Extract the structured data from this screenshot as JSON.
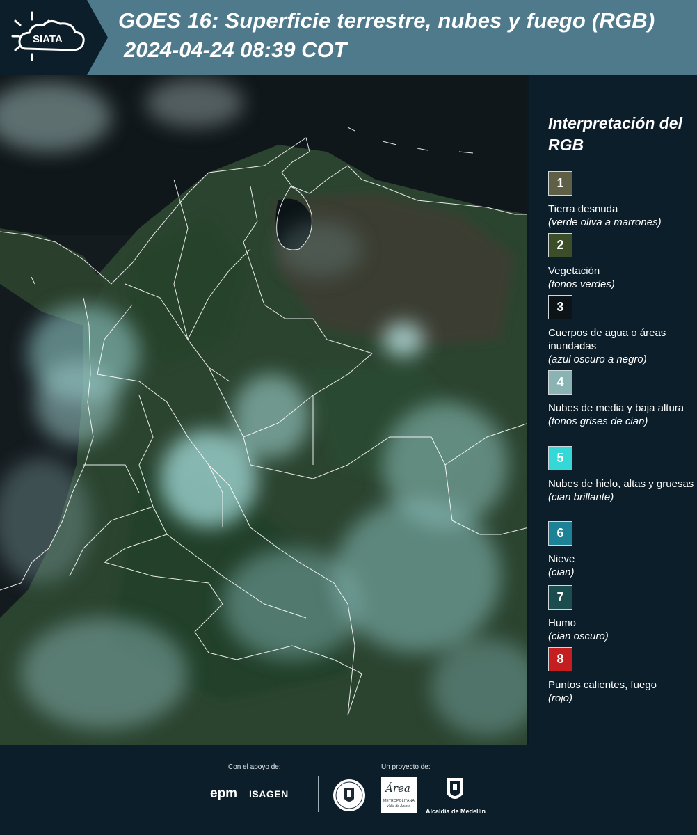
{
  "header": {
    "logo_text": "SIATA",
    "title": "GOES 16: Superficie terrestre, nubes y fuego (RGB)",
    "datetime": "2024-04-24 08:39 COT"
  },
  "legend": {
    "title": "Interpretación del RGB",
    "items": [
      {
        "number": "1",
        "label": "Tierra desnuda",
        "desc": "(verde oliva a marrones)",
        "color": "#5e5f45",
        "text_color": "#ffffff"
      },
      {
        "number": "2",
        "label": "Vegetación",
        "desc": "(tonos verdes)",
        "color": "#3b4e28",
        "text_color": "#ffffff"
      },
      {
        "number": "3",
        "label": "Cuerpos de agua o áreas inundadas",
        "desc": "(azul oscuro a negro)",
        "color": "#0c1417",
        "text_color": "#ffffff"
      },
      {
        "number": "4",
        "label": "Nubes de media y baja altura",
        "desc": "(tonos grises de cian)",
        "color": "#8ab3b3",
        "text_color": "#ffffff"
      },
      {
        "number": "5",
        "label": "Nubes de hielo, altas y gruesas",
        "desc": "(cian brillante)",
        "color": "#35d8d6",
        "text_color": "#ffffff"
      },
      {
        "number": "6",
        "label": "Nieve",
        "desc": "(cian)",
        "color": "#1e8296",
        "text_color": "#ffffff"
      },
      {
        "number": "7",
        "label": "Humo",
        "desc": "(cian oscuro)",
        "color": "#1b4c4e",
        "text_color": "#ffffff"
      },
      {
        "number": "8",
        "label": "Puntos calientes, fuego",
        "desc": "(rojo)",
        "color": "#c41e20",
        "text_color": "#ffffff"
      }
    ]
  },
  "footer": {
    "support_label": "Con el apoyo de:",
    "project_label": "Un proyecto de:",
    "sponsor1": "epm",
    "sponsor2": "ISAGEN",
    "area_name": "Área",
    "area_sub": "METROPOLITANA",
    "area_sub2": "Valle de Aburrá",
    "alcaldia": "Alcaldía de Medellín"
  }
}
